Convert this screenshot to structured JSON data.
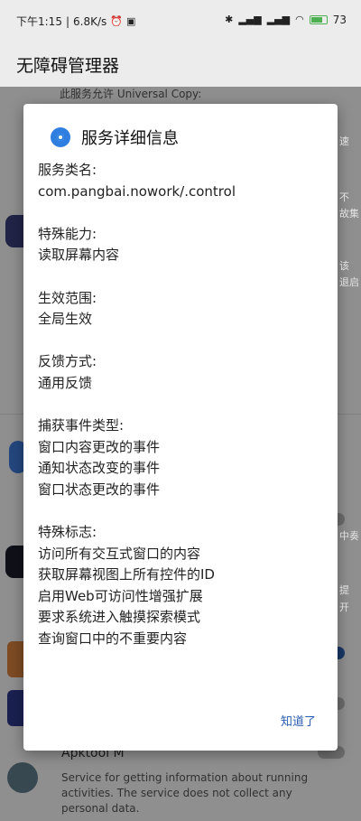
{
  "status_bar": {
    "time": "下午1:15",
    "net_speed": "6.8K/s",
    "battery_text": "73"
  },
  "app": {
    "title": "无障碍管理器"
  },
  "background": {
    "top_text": "此服务允许 Universal Copy:",
    "right_fragments": [
      "速",
      "不",
      "故集",
      "该",
      "退启",
      "中奏",
      "提",
      "开"
    ],
    "bottom_app_name": "Apktool M",
    "bottom_description": "Service for getting information about running activities. The service does not collect any personal data."
  },
  "dialog": {
    "title": "服务详细信息",
    "sections": [
      {
        "heading": "服务类名:",
        "lines": [
          "com.pangbai.nowork/.control"
        ]
      },
      {
        "heading": "特殊能力:",
        "lines": [
          "读取屏幕内容"
        ]
      },
      {
        "heading": "生效范围:",
        "lines": [
          "全局生效"
        ]
      },
      {
        "heading": "反馈方式:",
        "lines": [
          "通用反馈"
        ]
      },
      {
        "heading": "捕获事件类型:",
        "lines": [
          "窗口内容更改的事件",
          "通知状态改变的事件",
          "窗口状态更改的事件"
        ]
      },
      {
        "heading": "特殊标志:",
        "lines": [
          "访问所有交互式窗口的内容",
          "获取屏幕视图上所有控件的ID",
          "启用Web可访问性增强扩展",
          "要求系统进入触摸探索模式",
          "查询窗口中的不重要内容"
        ]
      }
    ],
    "ok_label": "知道了"
  },
  "colors": {
    "accent": "#2a5db0",
    "icon_blue": "#2f7fe0",
    "battery_green": "#4caf50"
  }
}
